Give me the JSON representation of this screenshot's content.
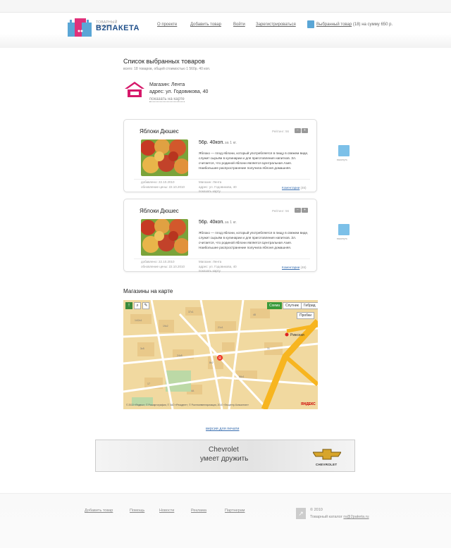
{
  "header": {
    "logo_small": "ТОВАРНЫЙ КАТАЛОГ",
    "logo_big": "В2ПАКЕТА",
    "nav": [
      "О проекте",
      "Добавить товар",
      "Войти",
      "Зарегистрироваться"
    ],
    "basket_link": "Выбранный товар",
    "basket_rest": "(18) на сумму 650 р."
  },
  "page": {
    "title": "Список выбранных товаров",
    "subtitle": "всего: 18 товаров, общей стоимостью 1 560р. 40 коп."
  },
  "store": {
    "name": "Магазин: Лента",
    "address": "адрес: ул. Годовикова, 40",
    "map_link": "показать на карте"
  },
  "products": [
    {
      "title": "Яблоки Дюшес",
      "rating": "Рейтинг: 56",
      "price": "56р. 40коп.",
      "per": "за 1 кг.",
      "desc": "Яблоко — плод яблони, который употребляется в пищу в свежем виде, служит сырьём в кулинарии и для приготовления напитков. Зл. считается, что родиной яблони является Центральная Азия. Наибольшее распространение получила яблоня домашняя.",
      "added": "добавлено: 22.10.2010",
      "updated": "обновление цены: 22.10.2010",
      "shop": "Магазин: Лента",
      "shop_addr": "адрес: ул. Годовикова, 40",
      "shop_map": "показать карту",
      "comments_label": "Коментарии",
      "comments_count": "(46)",
      "to_basket": "выкинуть"
    },
    {
      "title": "Яблоки Дюшес",
      "rating": "Рейтинг: 56",
      "price": "56р. 40коп.",
      "per": "за 1 кг.",
      "desc": "Яблоко — плод яблони, который употребляется в пищу в свежем виде, служит сырьём в кулинарии и для приготовления напитков. Зл. считается, что родиной яблони является Центральная Азия. Наибольшее распространение получила яблоня домашняя.",
      "added": "добавлено: 22.10.2010",
      "updated": "обновление цены: 22.10.2010",
      "shop": "Магазин: Лента",
      "shop_addr": "адрес: ул. Годовикова, 40",
      "shop_map": "показать карту",
      "comments_label": "Коментарии",
      "comments_count": "(46)",
      "to_basket": "выкинуть"
    }
  ],
  "map_section": {
    "title": "Магазины на карте",
    "type_buttons": [
      "Схема",
      "Спутник",
      "Гибрид"
    ],
    "traffic": "Пробки",
    "metro": "Рижская",
    "copyright": "© 2010 «Яндекс», © Роскартография, © ЗАО «Резидент», © Ростехинвентаризация, 2010 «Геоцентр-Консалтинг»",
    "brand": "ЯНДЕКС"
  },
  "print_link": "версия для печати",
  "banner": {
    "line1": "Chevrolet",
    "line2": "умеет дружить",
    "brand": "CHEVROLET"
  },
  "footer": {
    "links": [
      "Добавить товар",
      "Помощь",
      "Новости",
      "Реклама",
      "Партнерам"
    ],
    "copyright": "© 2010",
    "catalog_label": "Товарный каталог",
    "email": "rs@2paketa.ru"
  }
}
